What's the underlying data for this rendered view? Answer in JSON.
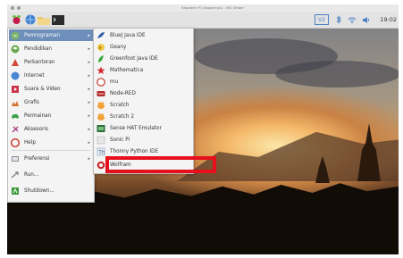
{
  "window": {
    "title": "Raspberry Pi (raspberrypi) - VNC Viewer"
  },
  "taskbar": {
    "launchers": [
      "raspberry-icon",
      "web-browser-icon",
      "file-manager-icon",
      "terminal-icon"
    ],
    "tray": {
      "vnc_label": "V2",
      "clock": "19:02"
    }
  },
  "main_menu": {
    "items": [
      {
        "label": "Pemrograman",
        "icon": "programming-icon",
        "has_submenu": true,
        "selected": true
      },
      {
        "label": "Pendidikan",
        "icon": "education-icon",
        "has_submenu": true
      },
      {
        "label": "Perkantoran",
        "icon": "office-icon",
        "has_submenu": true
      },
      {
        "label": "Internet",
        "icon": "internet-icon",
        "has_submenu": true
      },
      {
        "label": "Suara & Video",
        "icon": "sound-video-icon",
        "has_submenu": true
      },
      {
        "label": "Grafis",
        "icon": "graphics-icon",
        "has_submenu": true
      },
      {
        "label": "Permainan",
        "icon": "games-icon",
        "has_submenu": true
      },
      {
        "label": "Aksesoris",
        "icon": "accessories-icon",
        "has_submenu": true
      },
      {
        "label": "Help",
        "icon": "help-icon",
        "has_submenu": true
      },
      {
        "label": "Preferensi",
        "icon": "preferences-icon",
        "has_submenu": true
      },
      {
        "label": "Run...",
        "icon": "run-icon",
        "has_submenu": false
      },
      {
        "label": "Shutdown...",
        "icon": "shutdown-icon",
        "has_submenu": false
      }
    ]
  },
  "submenu": {
    "items": [
      {
        "label": "BlueJ Java IDE",
        "icon": "bluej-icon"
      },
      {
        "label": "Geany",
        "icon": "geany-icon"
      },
      {
        "label": "Greenfoot Java IDE",
        "icon": "greenfoot-icon"
      },
      {
        "label": "Mathematica",
        "icon": "mathematica-icon"
      },
      {
        "label": "mu",
        "icon": "mu-icon"
      },
      {
        "label": "Node-RED",
        "icon": "node-red-icon"
      },
      {
        "label": "Scratch",
        "icon": "scratch-icon"
      },
      {
        "label": "Scratch 2",
        "icon": "scratch2-icon"
      },
      {
        "label": "Sense HAT Emulator",
        "icon": "sense-hat-icon"
      },
      {
        "label": "Sonic Pi",
        "icon": "sonic-pi-icon"
      },
      {
        "label": "Thonny Python IDE",
        "icon": "thonny-icon",
        "highlighted": true
      },
      {
        "label": "Wolfram",
        "icon": "wolfram-icon"
      }
    ]
  },
  "colors": {
    "menu_selection": "#6d8fb9",
    "annotation_box": "#e5101c"
  }
}
